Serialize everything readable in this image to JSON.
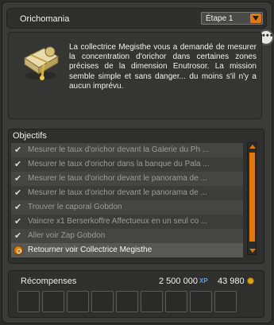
{
  "header": {
    "title": "Orichomania",
    "step_value": "Étape 1"
  },
  "description": {
    "text": "La collectrice Megisthe vous a demandé de mesurer la concentration d'orichor dans certaines zones précises de la dimension Enutrosor. La mission semble simple et sans danger... du moins s'il n'y a aucun imprévu."
  },
  "chat_bubble": {
    "label": "•••"
  },
  "objectives": {
    "header": "Objectifs",
    "items": [
      {
        "text": "Mesurer le taux d'orichor devant la Galerie du Ph ...",
        "done": true
      },
      {
        "text": "Mesurer le taux d'orichor dans la banque du Pala ...",
        "done": true
      },
      {
        "text": "Mesurer le taux d'orichor devant le panorama de ...",
        "done": true
      },
      {
        "text": "Mesurer le taux d'orichor devant le panorama de ...",
        "done": true
      },
      {
        "text": "Trouver le caporal Gobdon",
        "done": true
      },
      {
        "text": "Vaincre x1 Berserkoffre Affectueux en un seul co ...",
        "done": true
      },
      {
        "text": "Aller voir Zap Gobdon",
        "done": true
      },
      {
        "text": "Retourner voir Collectrice Megisthe",
        "done": false
      }
    ],
    "check_glyph": "✔"
  },
  "rewards": {
    "header": "Récompenses",
    "xp": "2 500 000",
    "xp_icon_label": "XP",
    "kamas": "43 980"
  },
  "colors": {
    "accent": "#e07a10",
    "panel_bg": "#3a3a38"
  },
  "icons": {
    "quest": "map-scroll-icon",
    "dropdown": "chevron-down-icon",
    "chat": "chat-bubble-icon",
    "current_objective": "current-objective-icon",
    "xp": "xp-icon",
    "kamas": "kamas-icon"
  }
}
